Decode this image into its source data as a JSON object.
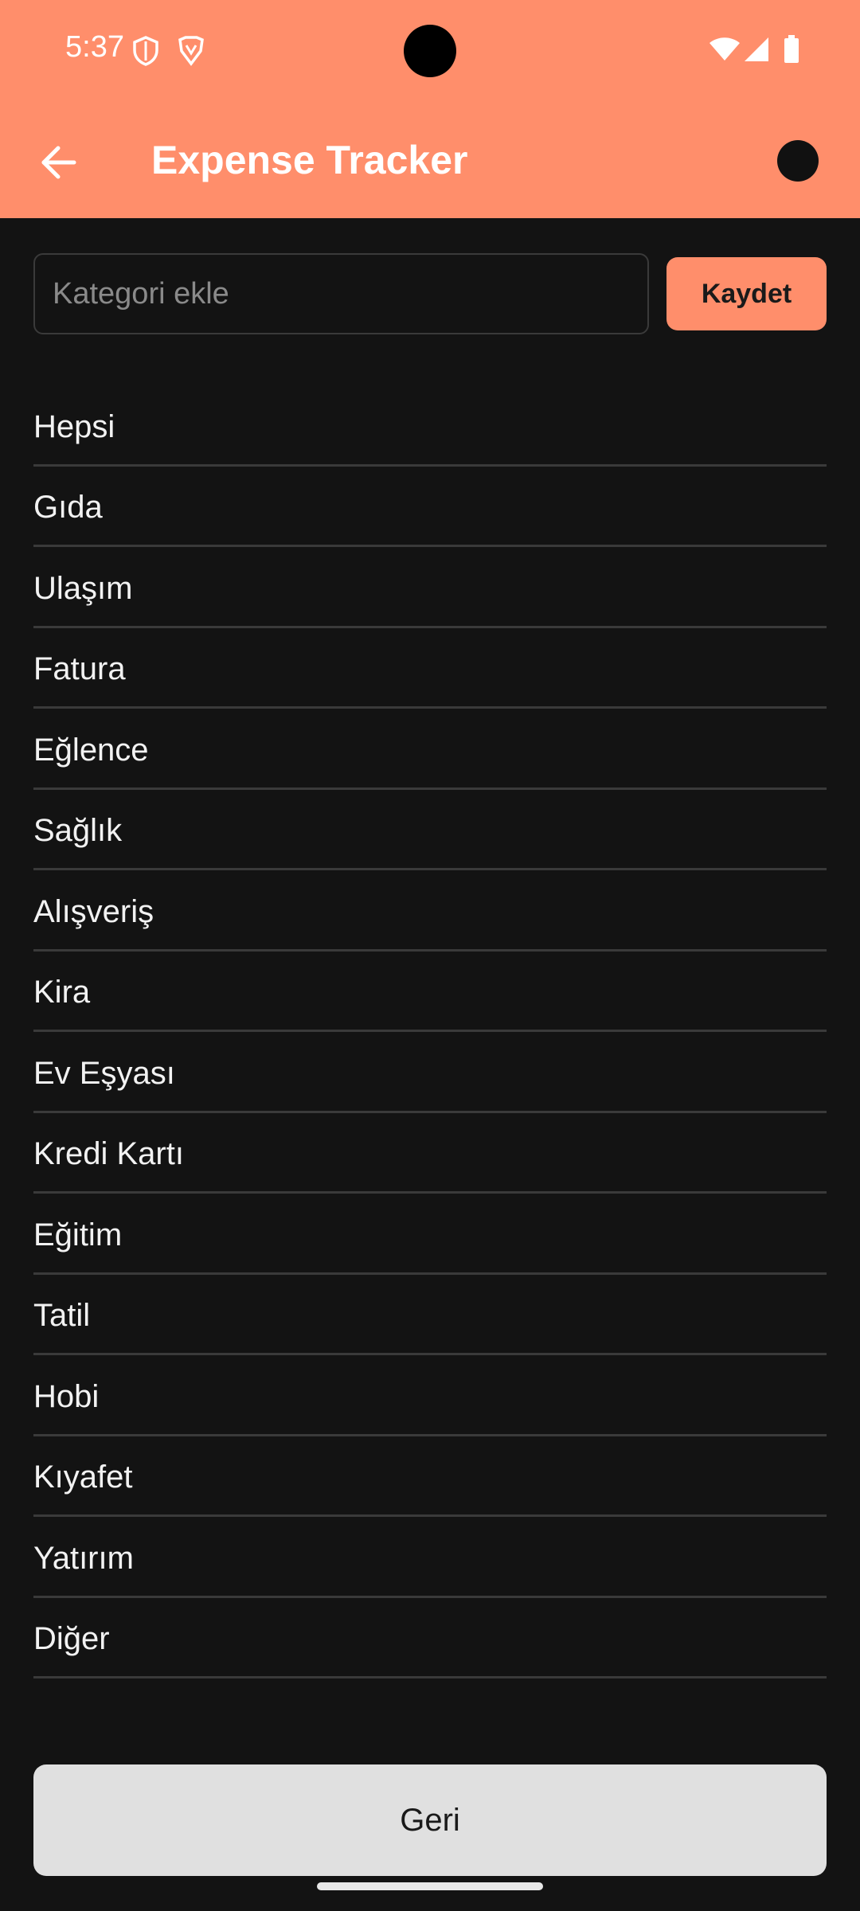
{
  "status_bar": {
    "time": "5:37",
    "left_icons": [
      "shield-icon",
      "brave-lion-icon"
    ],
    "right_icons": [
      "wifi-icon",
      "cellular-signal-icon",
      "battery-icon"
    ]
  },
  "app_bar": {
    "title": "Expense Tracker",
    "back_icon": "arrow-back-icon"
  },
  "category_form": {
    "input_value": "",
    "input_placeholder": "Kategori ekle",
    "save_label": "Kaydet"
  },
  "categories": [
    "Hepsi",
    "Gıda",
    "Ulaşım",
    "Fatura",
    "Eğlence",
    "Sağlık",
    "Alışveriş",
    "Kira",
    "Ev Eşyası",
    "Kredi Kartı",
    "Eğitim",
    "Tatil",
    "Hobi",
    "Kıyafet",
    "Yatırım",
    "Diğer"
  ],
  "footer": {
    "back_label": "Geri"
  },
  "colors": {
    "accent": "#FF8E6B",
    "background": "#131313",
    "divider": "#3a3a3a",
    "secondary_button": "#E0E0E0"
  }
}
